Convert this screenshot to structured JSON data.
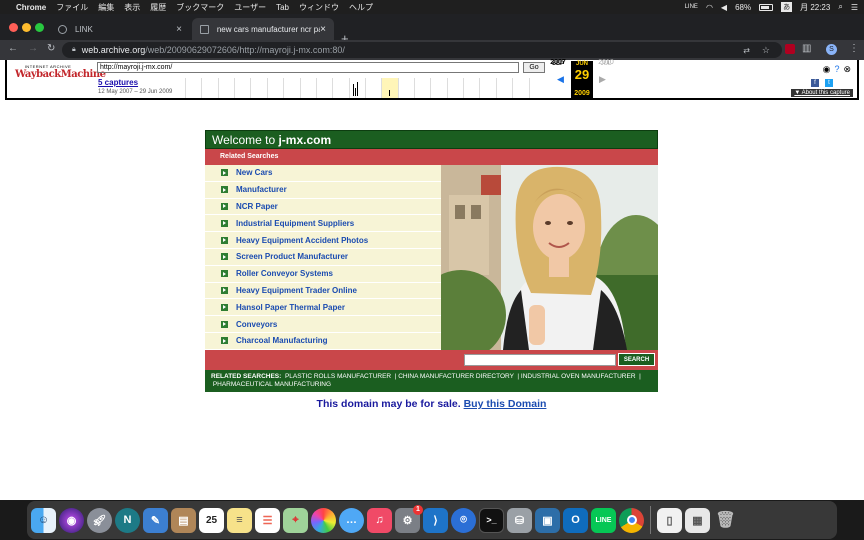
{
  "menubar": {
    "app": "Chrome",
    "items": [
      "ファイル",
      "編集",
      "表示",
      "履歴",
      "ブックマーク",
      "ユーザー",
      "Tab",
      "ウィンドウ",
      "ヘルプ"
    ],
    "battery": "68%",
    "datetime": "月 22:23"
  },
  "tabs": [
    {
      "title": "LINK"
    },
    {
      "title": "new cars manufacturer ncr pa"
    }
  ],
  "address": {
    "host": "web.archive.org",
    "path": "/web/20090629072606/http://mayroji.j-mx.com:80/"
  },
  "wayback": {
    "logo_top": "INTERNET ARCHIVE",
    "logo_main": "WaybackMachine",
    "url_value": "http://mayroji.j-mx.com/",
    "go_label": "Go",
    "captures": "5 captures",
    "range": "12 May 2007 – 29 Jun 2009",
    "months": [
      {
        "month": "SEP",
        "year": "2007"
      },
      {
        "month": "JUN",
        "day": "29",
        "year": "2009"
      },
      {
        "month": "JUL",
        "year": "2010"
      }
    ],
    "about": "About this capture"
  },
  "site": {
    "header_prefix": "Welcome to ",
    "header_domain": "j-mx.com",
    "related_title": "Related Searches",
    "links": [
      "New Cars",
      "Manufacturer",
      "NCR Paper",
      "Industrial Equipment Suppliers",
      "Heavy Equipment Accident Photos",
      "Screen Product Manufacturer",
      "Roller Conveyor Systems",
      "Heavy Equipment Trader Online",
      "Hansol Paper Thermal Paper",
      "Conveyors",
      "Charcoal Manufacturing"
    ],
    "search_label": "SEARCH",
    "footer_label": "RELATED SEARCHES:",
    "footer_links": [
      "PLASTIC ROLLS MANUFACTURER",
      "CHINA MANUFACTURER DIRECTORY",
      "INDUSTRIAL OVEN MANUFACTURER",
      "PHARMACEUTICAL MANUFACTURING"
    ],
    "sale_text": "This domain may be for sale.",
    "sale_link": "Buy this Domain"
  },
  "dock": {
    "calendar_day": "25",
    "badge_count": "1"
  },
  "colors": {
    "site_green": "#1b5e20",
    "site_red": "#c9474a",
    "link_blue": "#1a4bb0"
  }
}
